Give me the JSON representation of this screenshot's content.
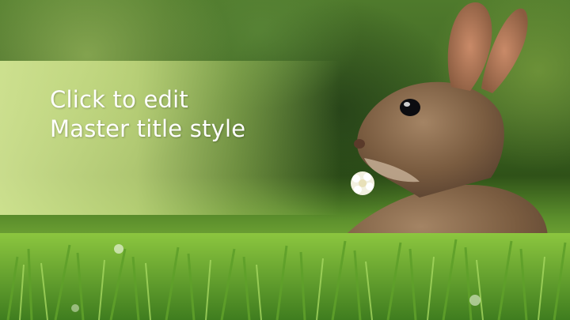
{
  "slide": {
    "title_lines": [
      "Click to edit",
      "Master title style"
    ]
  },
  "image": {
    "subject": "rabbit-with-clover-in-grass"
  },
  "colors": {
    "title_text": "#ffffff",
    "panel": "#d6e896"
  }
}
